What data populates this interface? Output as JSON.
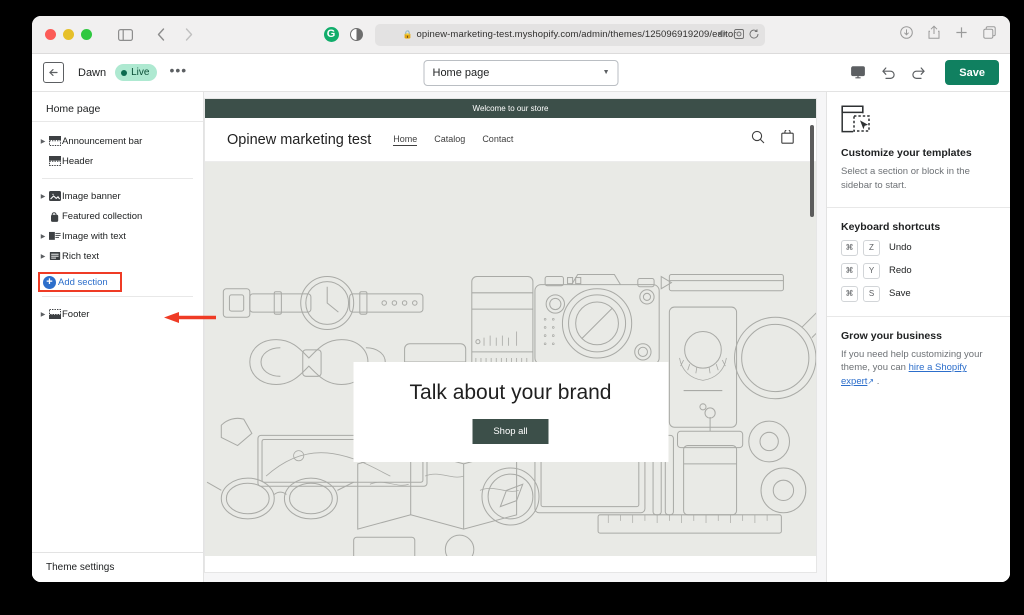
{
  "browser": {
    "url": "opinew-marketing-test.myshopify.com/admin/themes/125096919209/editor",
    "lock_icon": "lock-icon",
    "traffic_lights": [
      "close",
      "minimize",
      "maximize"
    ],
    "sidebar_toggle_icon": "sidebar-toggle-icon",
    "back_icon": "chevron-left-icon",
    "forward_icon": "chevron-right-icon",
    "grammarly_icon_letter": "G",
    "contrast_icon": "contrast-icon",
    "url_icons": [
      "volume-icon",
      "extension-icon",
      "reload-icon"
    ],
    "right_icons": [
      "download-icon",
      "share-icon",
      "new-tab-icon",
      "tab-overview-icon"
    ]
  },
  "toolbar": {
    "exit_icon": "exit-editor-icon",
    "theme_name": "Dawn",
    "live_badge": "Live",
    "more_label": "•••",
    "template_selected": "Home page",
    "caret_icon": "chevron-down-icon",
    "device_icon": "desktop-preview-icon",
    "undo_icon": "undo-icon",
    "redo_icon": "redo-icon",
    "save_label": "Save",
    "save_color": "#108060"
  },
  "sidebar": {
    "header": "Home page",
    "groups": [
      {
        "items": [
          {
            "label": "Announcement bar",
            "icon": "announcement-bar-icon",
            "expandable": true
          },
          {
            "label": "Header",
            "icon": "header-icon",
            "expandable": false
          }
        ]
      },
      {
        "items": [
          {
            "label": "Image banner",
            "icon": "image-banner-icon",
            "expandable": true
          },
          {
            "label": "Featured collection",
            "icon": "featured-collection-icon",
            "expandable": false
          },
          {
            "label": "Image with text",
            "icon": "image-with-text-icon",
            "expandable": true
          },
          {
            "label": "Rich text",
            "icon": "rich-text-icon",
            "expandable": true
          }
        ]
      }
    ],
    "add_section": {
      "label": "Add section",
      "icon": "add-circle-icon",
      "highlight_color": "#ef3b25",
      "link_color": "#2c6ecb"
    },
    "footer": {
      "label": "Footer",
      "icon": "footer-icon",
      "expandable": true
    },
    "theme_settings": "Theme settings"
  },
  "annotation": {
    "arrow_color": "#ef3b25",
    "arrow_name": "red-pointer-arrow"
  },
  "preview": {
    "announcement": "Welcome to our store",
    "announcement_color": "#3c4f49",
    "store_name": "Opinew marketing test",
    "nav": [
      {
        "label": "Home",
        "active": true
      },
      {
        "label": "Catalog",
        "active": false
      },
      {
        "label": "Contact",
        "active": false
      }
    ],
    "search_icon": "search-icon",
    "cart_icon": "shopping-bag-icon",
    "hero": {
      "title": "Talk about your brand",
      "button": "Shop all",
      "button_color": "#3c4f49",
      "background_color": "#e9eae6"
    }
  },
  "right_panel": {
    "illustration_icon": "customize-template-icon",
    "customize": {
      "title": "Customize your templates",
      "text": "Select a section or block in the sidebar to start."
    },
    "shortcuts": {
      "title": "Keyboard shortcuts",
      "items": [
        {
          "mod": "⌘",
          "key": "Z",
          "label": "Undo"
        },
        {
          "mod": "⌘",
          "key": "Y",
          "label": "Redo"
        },
        {
          "mod": "⌘",
          "key": "S",
          "label": "Save"
        }
      ]
    },
    "grow": {
      "title": "Grow your business",
      "text_before": "If you need help customizing your theme, you can ",
      "link": "hire a Shopify expert",
      "external_icon": "external-link-icon",
      "text_after": " ."
    }
  }
}
